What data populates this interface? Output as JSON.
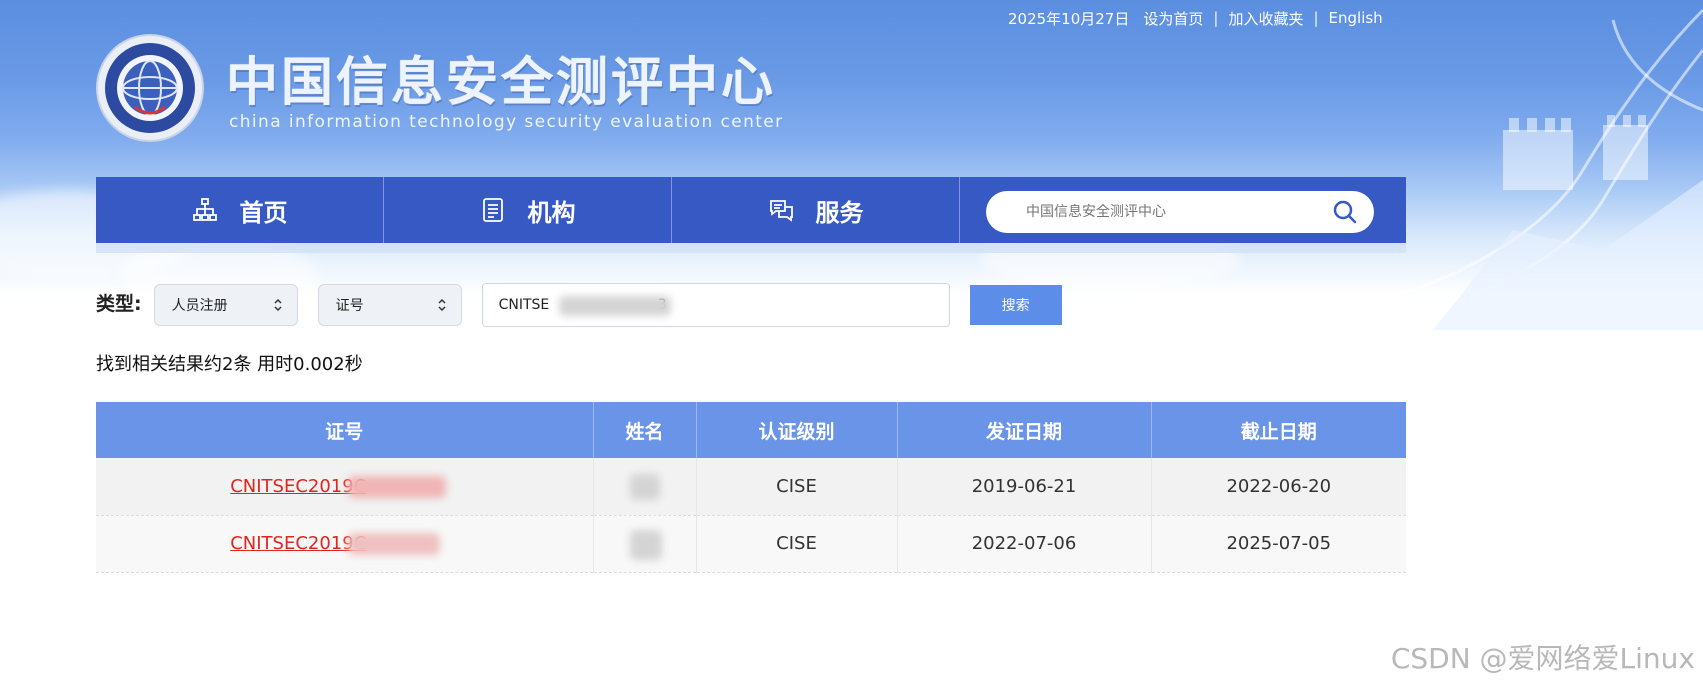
{
  "toplinks": {
    "date": "2025年10月27日",
    "set_home": "设为首页",
    "add_favorite": "加入收藏夹",
    "english": "English",
    "separator": "|"
  },
  "header": {
    "title": "中国信息安全测评中心",
    "subtitle": "china information technology security evaluation center"
  },
  "nav": {
    "items": [
      {
        "label": "首页",
        "icon": "sitemap-icon"
      },
      {
        "label": "机构",
        "icon": "document-icon"
      },
      {
        "label": "服务",
        "icon": "chat-icon"
      }
    ],
    "search_placeholder": "中国信息安全测评中心"
  },
  "filter": {
    "label": "类型:",
    "type_select": "人员注册",
    "field_select": "证号",
    "query_prefix": "CNITSE",
    "query_suffix": ".3",
    "search_button": "搜索"
  },
  "result_info": "找到相关结果约2条 用时0.002秒",
  "table": {
    "headers": [
      "证号",
      "姓名",
      "认证级别",
      "发证日期",
      "截止日期"
    ],
    "rows": [
      {
        "cert": "CNITSEC2019C",
        "level": "CISE",
        "issue_date": "2019-06-21",
        "expire_date": "2022-06-20"
      },
      {
        "cert": "CNITSEC2019C",
        "level": "CISE",
        "issue_date": "2022-07-06",
        "expire_date": "2025-07-05"
      }
    ]
  },
  "watermark": "CSDN @爱网络爱Linux",
  "colors": {
    "nav_bg": "#3759c4",
    "table_header": "#6a94e8",
    "link_red": "#e0251e",
    "button_blue": "#5c8de8"
  }
}
